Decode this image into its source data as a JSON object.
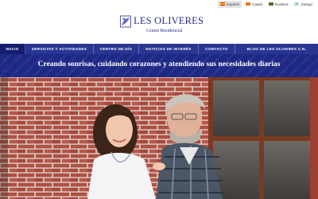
{
  "languages": [
    {
      "label": "Español",
      "active": true,
      "flag": "es"
    },
    {
      "label": "Català",
      "active": false,
      "flag": "ca"
    },
    {
      "label": "Euskera",
      "active": false,
      "flag": "eu"
    },
    {
      "label": "Galego",
      "active": false,
      "flag": "gl"
    }
  ],
  "brand": {
    "title": "LES OLIVERES",
    "subtitle": "Centre Residencial",
    "color": "#2a2e86"
  },
  "nav": {
    "items": [
      {
        "label": "INICIO"
      },
      {
        "label": "SERVICIOS Y ACTIVIDADES"
      },
      {
        "label": "CENTRO DE DÍA"
      },
      {
        "label": "NOTICIAS DE INTERÉS"
      },
      {
        "label": "CONTACTO"
      },
      {
        "label": "BLOG DE LES OLIVERES C.R."
      }
    ],
    "active_index": 0,
    "color": "#283593"
  },
  "banner": {
    "text": "Creando sonrisas, cuidando corazones y atendiendo sus necesidades diarias"
  },
  "hero": {
    "image_description_icon": "caregiver-with-elderly-man-photo"
  }
}
